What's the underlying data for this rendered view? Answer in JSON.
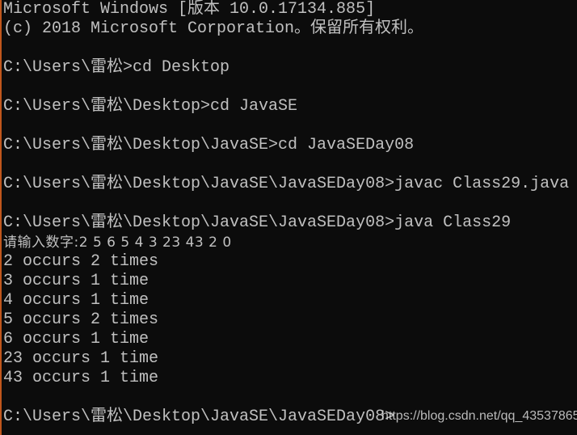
{
  "console": {
    "lines": [
      "Microsoft Windows [版本 10.0.17134.885]",
      "(c) 2018 Microsoft Corporation。保留所有权利。",
      "",
      "C:\\Users\\雷松>cd Desktop",
      "",
      "C:\\Users\\雷松\\Desktop>cd JavaSE",
      "",
      "C:\\Users\\雷松\\Desktop\\JavaSE>cd JavaSEDay08",
      "",
      "C:\\Users\\雷松\\Desktop\\JavaSE\\JavaSEDay08>javac Class29.java",
      "",
      "C:\\Users\\雷松\\Desktop\\JavaSE\\JavaSEDay08>java Class29",
      "请输入数字:2 5 6 5 4 3 23 43 2 0",
      "2 occurs 2 times",
      "3 occurs 1 time",
      "4 occurs 1 time",
      "5 occurs 2 times",
      "6 occurs 1 time",
      "23 occurs 1 time",
      "43 occurs 1 time",
      "",
      "C:\\Users\\雷松\\Desktop\\JavaSE\\JavaSEDay08>"
    ],
    "watermark": "https://blog.csdn.net/qq_43537865"
  }
}
